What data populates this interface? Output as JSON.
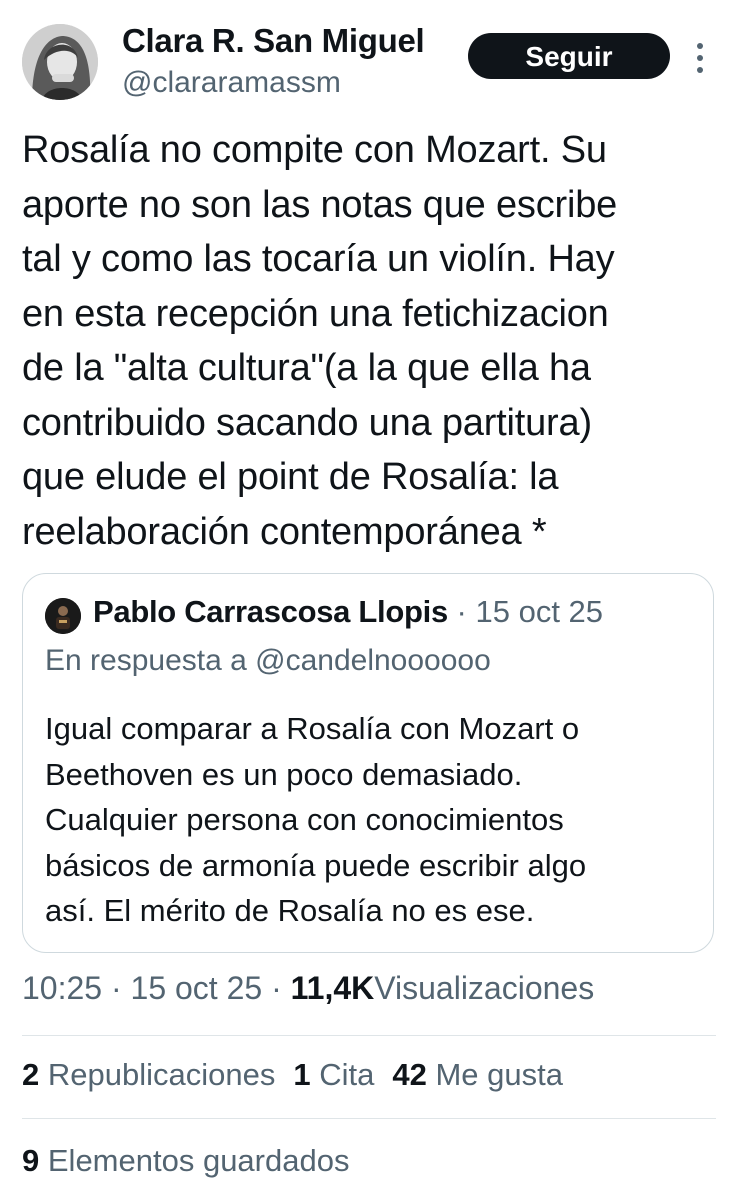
{
  "author": {
    "name": "Clara R. San Miguel",
    "handle": "@clararamassm",
    "avatar_icon": "profile-photo-icon"
  },
  "follow_label": "Seguir",
  "more_icon": "more-vertical-icon",
  "tweet_text": "Rosalía no compite con Mozart. Su\naporte no son las notas que escribe\ntal y como las tocaría un violín. Hay\nen esta recepción una fetichizacion\nde la \"alta cultura\"(a la que ella ha\ncontribuido sacando una partitura)\nque elude el point de Rosalía: la\nreelaboración contemporánea *",
  "quote": {
    "name": "Pablo Carrascosa Llopis",
    "separator": "·",
    "date": "15 oct 25",
    "reply_to": "En respuesta a @candelnoooooo",
    "text": "Igual comparar a Rosalía con Mozart o\nBeethoven es un poco demasiado.\nCualquier persona con conocimientos\nbásicos de armonía puede escribir algo\nasí. El mérito de Rosalía no es ese."
  },
  "meta": {
    "time": "10:25",
    "sep1": "·",
    "date": "15 oct 25",
    "sep2": "·",
    "views_count": "11,4K",
    "views_label": "Visualizaciones"
  },
  "stats": {
    "reposts_count": "2",
    "reposts_label": "Republicaciones",
    "quotes_count": "1",
    "quotes_label": "Cita",
    "likes_count": "42",
    "likes_label": "Me gusta",
    "bookmarks_count": "9",
    "bookmarks_label": "Elementos guardados"
  },
  "colors": {
    "text_primary": "#0f1419",
    "text_secondary": "#536471",
    "border": "#cfd9de",
    "button_bg": "#0f1419"
  }
}
